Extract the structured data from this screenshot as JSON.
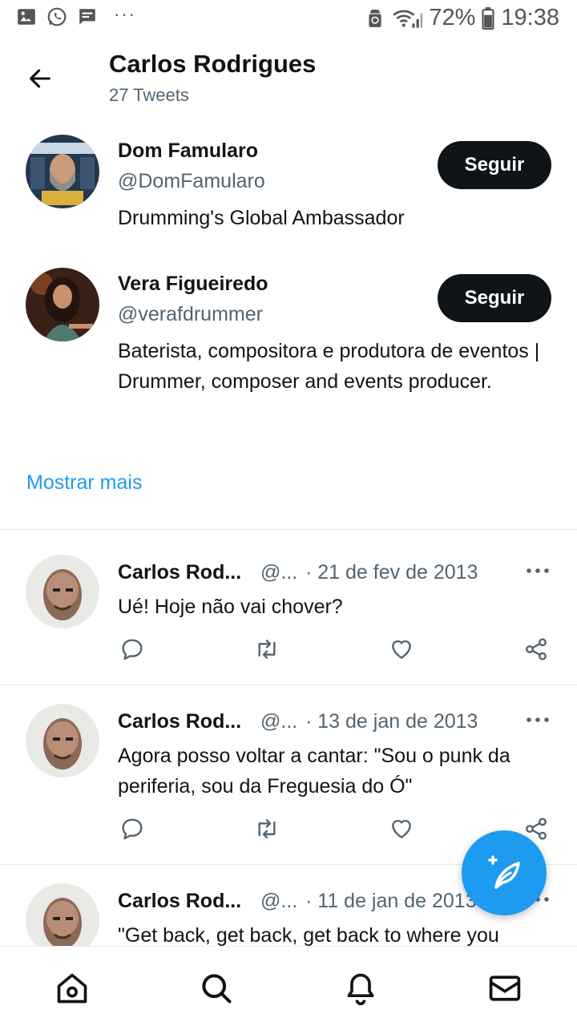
{
  "status_bar": {
    "battery": "72%",
    "time": "19:38",
    "dots": "···"
  },
  "header": {
    "title": "Carlos Rodrigues",
    "subtitle": "27 Tweets"
  },
  "suggested": [
    {
      "name": "Dom Famularo",
      "handle": "@DomFamularo",
      "bio": "Drumming's Global Ambassador",
      "button": "Seguir"
    },
    {
      "name": "Vera Figueiredo",
      "handle": "@verafdrummer",
      "bio": "Baterista, compositora e produtora de eventos | Drummer, composer and events producer.",
      "button": "Seguir"
    }
  ],
  "show_more": "Mostrar mais",
  "tweets": [
    {
      "name": "Carlos Rod...",
      "handle": "@...",
      "date": "· 21 de fev de 2013",
      "text": "Ué! Hoje não vai chover?"
    },
    {
      "name": "Carlos Rod...",
      "handle": "@...",
      "date": "· 13 de jan de 2013",
      "text": "Agora posso voltar a cantar: \"Sou o punk da periferia, sou da Freguesia do Ó\""
    },
    {
      "name": "Carlos Rod...",
      "handle": "@...",
      "date": "· 11 de jan de 2013",
      "text": "\"Get back, get back, get back to where you"
    }
  ],
  "colors": {
    "accent": "#1d9bf0",
    "text": "#0f1419",
    "secondary": "#536471"
  }
}
